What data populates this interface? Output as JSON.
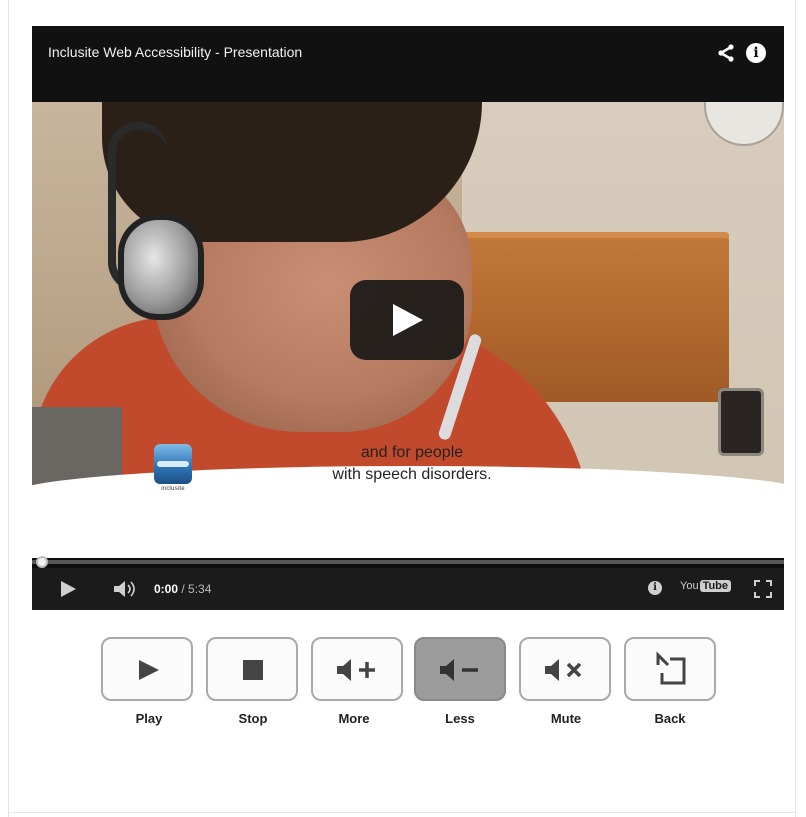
{
  "player": {
    "title": "Inclusite Web Accessibility - Presentation",
    "caption": {
      "line1": "and for people",
      "line2": "with speech disorders.",
      "logo_text": "inclusite"
    },
    "controls": {
      "current_time": "0:00",
      "duration": " / 5:34",
      "youtube_you": "You",
      "youtube_tube": "Tube",
      "progress": 0
    }
  },
  "buttons": [
    {
      "label": "Play"
    },
    {
      "label": "Stop"
    },
    {
      "label": "More"
    },
    {
      "label": "Less",
      "active": true
    },
    {
      "label": "Mute"
    },
    {
      "label": "Back"
    }
  ],
  "icons": {
    "share": "share-icon",
    "info": "info-icon",
    "play": "play-icon",
    "volume": "volume-icon",
    "youtube": "youtube-logo",
    "fullscreen": "fullscreen-icon"
  },
  "colors": {
    "player_bg": "#0c0c0c",
    "sweater": "#c24a2c",
    "headboard": "#b4692e",
    "button_active": "#9c9c9c"
  }
}
